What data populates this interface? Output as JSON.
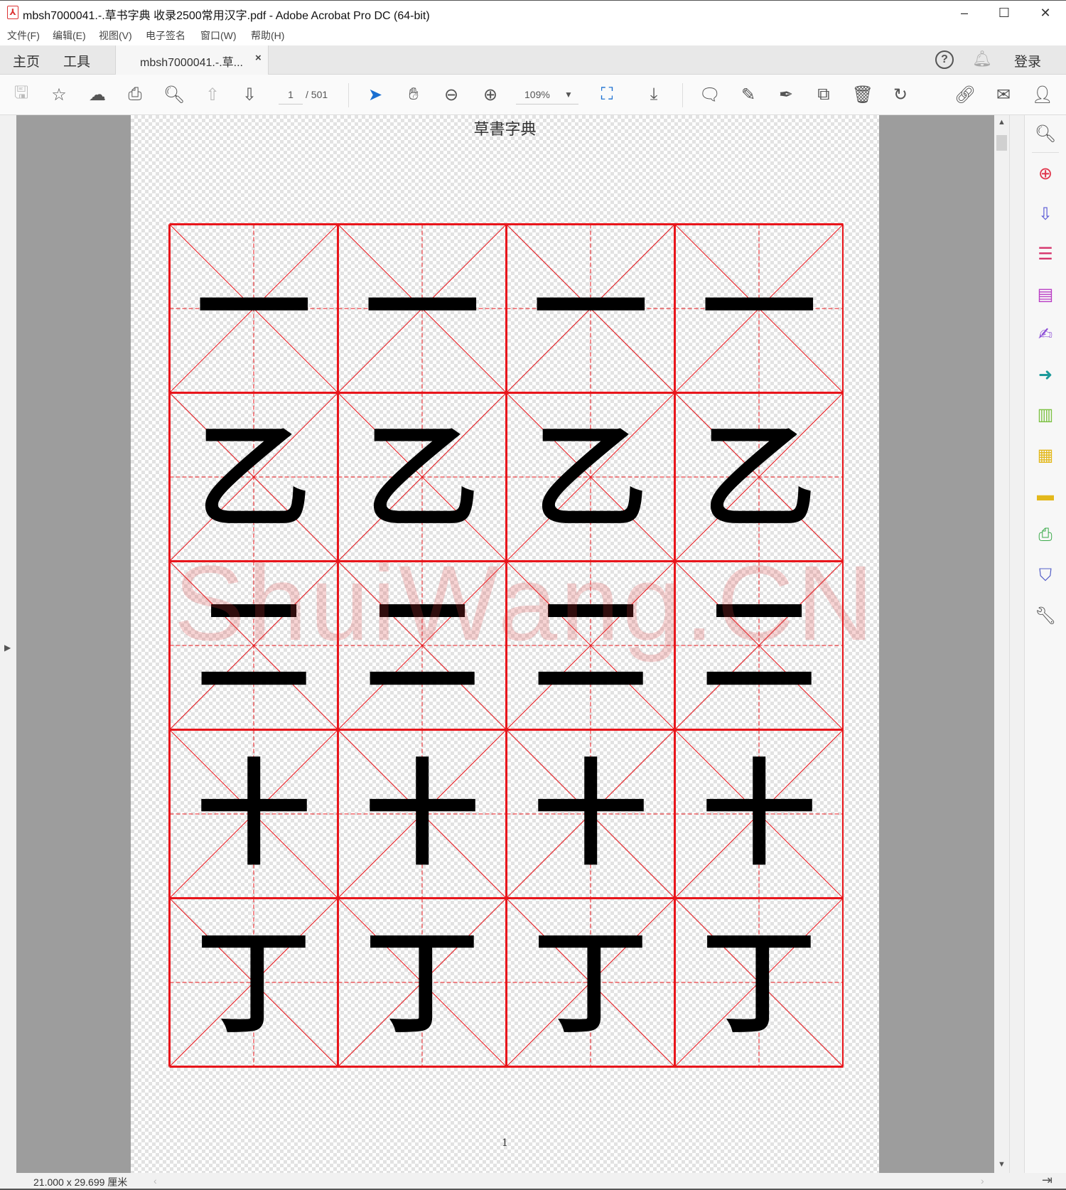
{
  "window": {
    "title": "mbsh7000041.-.草书字典 收录2500常用汉字.pdf - Adobe Acrobat Pro DC (64-bit)",
    "minimize": "–",
    "maximize": "☐",
    "close": "✕"
  },
  "menu": [
    "文件(F)",
    "编辑(E)",
    "视图(V)",
    "电子签名",
    "窗口(W)",
    "帮助(H)"
  ],
  "tabs": {
    "home": "主页",
    "tools": "工具",
    "document": "mbsh7000041.-.草...",
    "close": "×",
    "signin": "登录"
  },
  "toolbar": {
    "page_current": "1",
    "page_total": "/ 501",
    "zoom": "109%"
  },
  "document": {
    "header": "草書字典",
    "page_number": "1",
    "watermark": "ShuiWang.CN",
    "rows": [
      [
        "一",
        "一",
        "一",
        "一"
      ],
      [
        "乙",
        "乙",
        "乙",
        "乙"
      ],
      [
        "二",
        "二",
        "二",
        "二"
      ],
      [
        "十",
        "十",
        "十",
        "十"
      ],
      [
        "丁",
        "丁",
        "丁",
        "丁"
      ]
    ],
    "grid_color": "#e8151b"
  },
  "status": {
    "page_size": "21.000 x 29.699 厘米"
  },
  "right_panel_icons": [
    {
      "name": "enhance-scan-icon",
      "color": "#555555"
    },
    {
      "name": "create-pdf-icon",
      "color": "#e0344a"
    },
    {
      "name": "export-pdf-icon",
      "color": "#5b5bd6"
    },
    {
      "name": "edit-pdf-icon",
      "color": "#d6336c"
    },
    {
      "name": "organize-form-icon",
      "color": "#b93cc4"
    },
    {
      "name": "fill-sign-icon",
      "color": "#8a4bd6"
    },
    {
      "name": "send-review-icon",
      "color": "#1d9a9a"
    },
    {
      "name": "organize-pages-icon",
      "color": "#7cc142"
    },
    {
      "name": "comment-share-icon",
      "color": "#e3b81b"
    },
    {
      "name": "comment-icon",
      "color": "#e3b81b"
    },
    {
      "name": "print-production-icon",
      "color": "#3aaa4a"
    },
    {
      "name": "protect-icon",
      "color": "#5560c8"
    },
    {
      "name": "more-tools-icon",
      "color": "#555555"
    }
  ]
}
